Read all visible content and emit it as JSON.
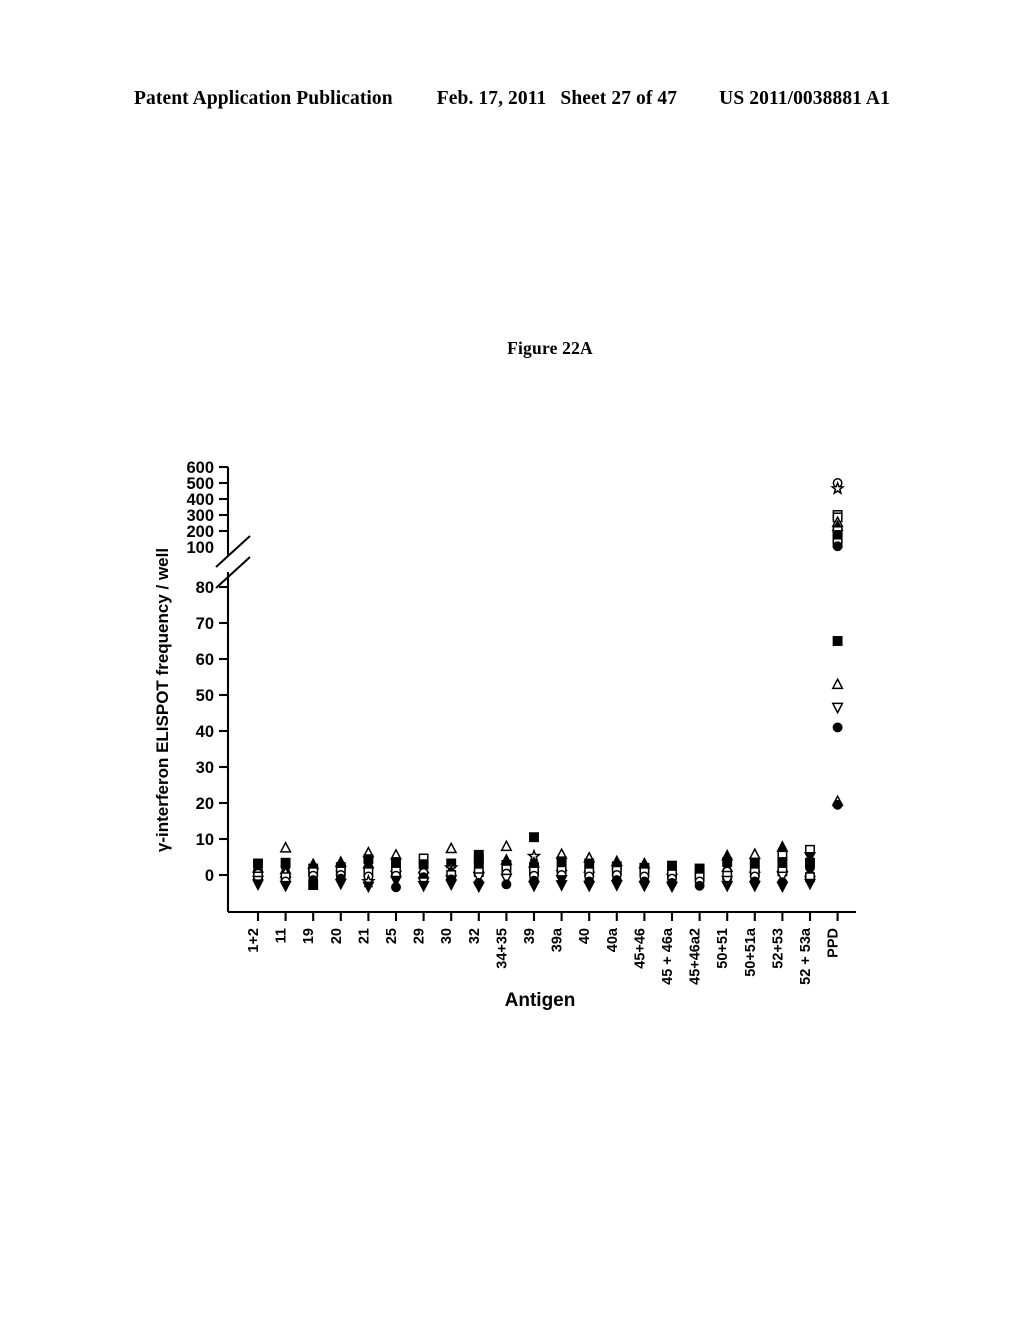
{
  "header": {
    "publication": "Patent Application Publication",
    "date": "Feb. 17, 2011",
    "sheet": "Sheet 27 of 47",
    "patent_number": "US 2011/0038881 A1"
  },
  "figure": {
    "title": "Figure 22A"
  },
  "chart_data": {
    "type": "scatter",
    "title": "Figure 22A",
    "xlabel": "Antigen",
    "ylabel": "γ-interferon ELISPOT frequency / well",
    "grid": false,
    "legend": "none",
    "axis_break": {
      "present": true,
      "lower_segment": [
        -5,
        80
      ],
      "upper_segment": [
        100,
        600
      ],
      "note": "y-axis broken between 80 and 100"
    },
    "ylim_lower": [
      -5,
      80
    ],
    "ylim_upper": [
      100,
      600
    ],
    "yticks_lower": [
      0,
      10,
      20,
      30,
      40,
      50,
      60,
      70,
      80
    ],
    "yticks_upper": [
      100,
      200,
      300,
      400,
      500,
      600
    ],
    "categories": [
      "1+2",
      "11",
      "19",
      "20",
      "21",
      "25",
      "29",
      "30",
      "32",
      "34+35",
      "39",
      "39a",
      "40",
      "40a",
      "45+46",
      "45 + 46a",
      "45+46a2",
      "50+51",
      "50+51a",
      "52+53",
      "52 + 53a",
      "PPD"
    ],
    "marker_shapes": [
      "filled-square",
      "open-square",
      "filled-triangle-up",
      "open-triangle-up",
      "filled-triangle-down",
      "open-triangle-down",
      "filled-circle",
      "open-circle",
      "star",
      "filled-diamond"
    ],
    "series": [
      {
        "name": "1+2",
        "points": [
          {
            "v": 3.2,
            "m": "filled-square"
          },
          {
            "v": 2.0,
            "m": "filled-triangle-up"
          },
          {
            "v": 1.2,
            "m": "filled-circle"
          },
          {
            "v": 0.4,
            "m": "open-circle"
          },
          {
            "v": -0.4,
            "m": "open-square"
          },
          {
            "v": -1.6,
            "m": "open-triangle-down"
          },
          {
            "v": -2.6,
            "m": "filled-triangle-down"
          }
        ]
      },
      {
        "name": "11",
        "points": [
          {
            "v": 7.6,
            "m": "open-triangle-up"
          },
          {
            "v": 3.4,
            "m": "filled-square"
          },
          {
            "v": 2.4,
            "m": "filled-circle"
          },
          {
            "v": 1.6,
            "m": "filled-triangle-up"
          },
          {
            "v": 0.6,
            "m": "open-triangle-up"
          },
          {
            "v": -0.6,
            "m": "open-square"
          },
          {
            "v": -1.8,
            "m": "open-circle"
          },
          {
            "v": -3.0,
            "m": "filled-triangle-down"
          }
        ]
      },
      {
        "name": "19",
        "points": [
          {
            "v": 3.0,
            "m": "filled-triangle-up"
          },
          {
            "v": 1.8,
            "m": "filled-square"
          },
          {
            "v": 0.8,
            "m": "open-square"
          },
          {
            "v": -0.2,
            "m": "open-circle"
          },
          {
            "v": -1.4,
            "m": "filled-circle"
          },
          {
            "v": -2.8,
            "m": "filled-square"
          }
        ]
      },
      {
        "name": "20",
        "points": [
          {
            "v": 3.6,
            "m": "filled-triangle-up"
          },
          {
            "v": 2.2,
            "m": "filled-square"
          },
          {
            "v": 1.0,
            "m": "open-square"
          },
          {
            "v": 0.0,
            "m": "open-circle"
          },
          {
            "v": -1.0,
            "m": "filled-circle"
          },
          {
            "v": -2.4,
            "m": "filled-triangle-down"
          }
        ]
      },
      {
        "name": "21",
        "points": [
          {
            "v": 6.2,
            "m": "open-triangle-up"
          },
          {
            "v": 4.4,
            "m": "filled-square"
          },
          {
            "v": 3.2,
            "m": "filled-triangle-up"
          },
          {
            "v": 2.0,
            "m": "filled-circle"
          },
          {
            "v": 0.8,
            "m": "open-square"
          },
          {
            "v": -0.4,
            "m": "open-circle"
          },
          {
            "v": -1.8,
            "m": "star"
          },
          {
            "v": -3.2,
            "m": "filled-triangle-down"
          }
        ]
      },
      {
        "name": "25",
        "points": [
          {
            "v": 5.6,
            "m": "open-triangle-up"
          },
          {
            "v": 3.6,
            "m": "filled-square"
          },
          {
            "v": 2.2,
            "m": "filled-triangle-up"
          },
          {
            "v": 1.0,
            "m": "open-square"
          },
          {
            "v": -0.2,
            "m": "open-circle"
          },
          {
            "v": -1.6,
            "m": "filled-triangle-down"
          },
          {
            "v": -3.4,
            "m": "filled-circle"
          }
        ]
      },
      {
        "name": "29",
        "points": [
          {
            "v": 4.6,
            "m": "open-square"
          },
          {
            "v": 3.0,
            "m": "filled-square"
          },
          {
            "v": 1.8,
            "m": "filled-triangle-up"
          },
          {
            "v": 0.6,
            "m": "open-circle"
          },
          {
            "v": -0.6,
            "m": "filled-circle"
          },
          {
            "v": -2.0,
            "m": "open-triangle-down"
          },
          {
            "v": -3.0,
            "m": "filled-triangle-down"
          }
        ]
      },
      {
        "name": "30",
        "points": [
          {
            "v": 7.4,
            "m": "open-triangle-up"
          },
          {
            "v": 3.2,
            "m": "filled-square"
          },
          {
            "v": 2.0,
            "m": "star"
          },
          {
            "v": 1.0,
            "m": "filled-triangle-up"
          },
          {
            "v": 0.0,
            "m": "open-square"
          },
          {
            "v": -1.2,
            "m": "filled-circle"
          },
          {
            "v": -2.6,
            "m": "filled-triangle-down"
          }
        ]
      },
      {
        "name": "32",
        "points": [
          {
            "v": 5.6,
            "m": "filled-square"
          },
          {
            "v": 4.4,
            "m": "filled-square"
          },
          {
            "v": 3.2,
            "m": "filled-square"
          },
          {
            "v": 2.0,
            "m": "filled-triangle-up"
          },
          {
            "v": 0.8,
            "m": "open-square"
          },
          {
            "v": -0.6,
            "m": "open-triangle-down"
          },
          {
            "v": -2.2,
            "m": "filled-circle"
          },
          {
            "v": -3.2,
            "m": "filled-triangle-down"
          }
        ]
      },
      {
        "name": "34+35",
        "points": [
          {
            "v": 8.0,
            "m": "open-triangle-up"
          },
          {
            "v": 4.2,
            "m": "filled-triangle-up"
          },
          {
            "v": 2.8,
            "m": "filled-square"
          },
          {
            "v": 1.6,
            "m": "open-square"
          },
          {
            "v": 0.4,
            "m": "open-circle"
          },
          {
            "v": -1.0,
            "m": "open-triangle-down"
          },
          {
            "v": -2.6,
            "m": "filled-circle"
          }
        ]
      },
      {
        "name": "39",
        "points": [
          {
            "v": 10.5,
            "m": "filled-square"
          },
          {
            "v": 5.2,
            "m": "star"
          },
          {
            "v": 3.4,
            "m": "filled-triangle-up"
          },
          {
            "v": 2.2,
            "m": "filled-square"
          },
          {
            "v": 1.0,
            "m": "open-square"
          },
          {
            "v": -0.2,
            "m": "open-circle"
          },
          {
            "v": -1.6,
            "m": "filled-circle"
          },
          {
            "v": -3.0,
            "m": "filled-triangle-down"
          }
        ]
      },
      {
        "name": "39a",
        "points": [
          {
            "v": 5.8,
            "m": "open-triangle-up"
          },
          {
            "v": 3.8,
            "m": "filled-square"
          },
          {
            "v": 2.4,
            "m": "filled-triangle-up"
          },
          {
            "v": 1.2,
            "m": "open-square"
          },
          {
            "v": 0.0,
            "m": "open-circle"
          },
          {
            "v": -1.4,
            "m": "filled-triangle-down"
          },
          {
            "v": -2.8,
            "m": "filled-triangle-down"
          }
        ]
      },
      {
        "name": "40",
        "points": [
          {
            "v": 4.8,
            "m": "open-triangle-up"
          },
          {
            "v": 3.2,
            "m": "filled-square"
          },
          {
            "v": 2.0,
            "m": "filled-triangle-up"
          },
          {
            "v": 0.8,
            "m": "open-square"
          },
          {
            "v": -0.4,
            "m": "open-circle"
          },
          {
            "v": -1.8,
            "m": "filled-circle"
          },
          {
            "v": -3.0,
            "m": "filled-triangle-down"
          }
        ]
      },
      {
        "name": "40a",
        "points": [
          {
            "v": 3.8,
            "m": "filled-triangle-up"
          },
          {
            "v": 2.4,
            "m": "filled-square"
          },
          {
            "v": 1.2,
            "m": "open-square"
          },
          {
            "v": 0.0,
            "m": "open-circle"
          },
          {
            "v": -1.4,
            "m": "filled-circle"
          },
          {
            "v": -2.8,
            "m": "filled-triangle-down"
          }
        ]
      },
      {
        "name": "45+46",
        "points": [
          {
            "v": 3.2,
            "m": "filled-triangle-up"
          },
          {
            "v": 2.0,
            "m": "filled-square"
          },
          {
            "v": 0.8,
            "m": "open-square"
          },
          {
            "v": -0.4,
            "m": "open-circle"
          },
          {
            "v": -1.8,
            "m": "filled-circle"
          },
          {
            "v": -3.0,
            "m": "filled-triangle-down"
          }
        ]
      },
      {
        "name": "45 + 46a",
        "points": [
          {
            "v": 2.6,
            "m": "filled-square"
          },
          {
            "v": 1.4,
            "m": "filled-triangle-up"
          },
          {
            "v": 0.2,
            "m": "open-square"
          },
          {
            "v": -1.0,
            "m": "open-circle"
          },
          {
            "v": -2.2,
            "m": "filled-circle"
          },
          {
            "v": -3.2,
            "m": "filled-triangle-down"
          }
        ]
      },
      {
        "name": "45+46a2",
        "points": [
          {
            "v": 1.8,
            "m": "filled-square"
          },
          {
            "v": 0.6,
            "m": "filled-square"
          },
          {
            "v": -0.6,
            "m": "open-square"
          },
          {
            "v": -1.8,
            "m": "open-circle"
          },
          {
            "v": -3.0,
            "m": "filled-circle"
          }
        ]
      },
      {
        "name": "50+51",
        "points": [
          {
            "v": 5.4,
            "m": "filled-triangle-up"
          },
          {
            "v": 3.6,
            "m": "filled-square"
          },
          {
            "v": 2.2,
            "m": "filled-triangle-up"
          },
          {
            "v": 1.0,
            "m": "open-circle"
          },
          {
            "v": -0.2,
            "m": "open-square"
          },
          {
            "v": -1.6,
            "m": "open-triangle-down"
          },
          {
            "v": -3.0,
            "m": "filled-triangle-down"
          }
        ]
      },
      {
        "name": "50+51a",
        "points": [
          {
            "v": 5.8,
            "m": "open-triangle-up"
          },
          {
            "v": 3.4,
            "m": "filled-square"
          },
          {
            "v": 2.0,
            "m": "filled-triangle-up"
          },
          {
            "v": 0.8,
            "m": "open-square"
          },
          {
            "v": -0.4,
            "m": "open-circle"
          },
          {
            "v": -1.8,
            "m": "filled-circle"
          },
          {
            "v": -3.0,
            "m": "filled-triangle-down"
          }
        ]
      },
      {
        "name": "52+53",
        "points": [
          {
            "v": 7.8,
            "m": "filled-triangle-up"
          },
          {
            "v": 5.4,
            "m": "open-square"
          },
          {
            "v": 3.6,
            "m": "filled-square"
          },
          {
            "v": 2.2,
            "m": "filled-triangle-up"
          },
          {
            "v": 1.0,
            "m": "open-square"
          },
          {
            "v": -0.4,
            "m": "open-triangle-down"
          },
          {
            "v": -2.0,
            "m": "filled-circle"
          },
          {
            "v": -3.2,
            "m": "filled-triangle-down"
          }
        ]
      },
      {
        "name": "52 + 53a",
        "points": [
          {
            "v": 7.0,
            "m": "open-square"
          },
          {
            "v": 5.0,
            "m": "filled-triangle-down"
          },
          {
            "v": 3.4,
            "m": "filled-square"
          },
          {
            "v": 2.0,
            "m": "filled-circle"
          },
          {
            "v": 0.8,
            "m": "filled-triangle-up"
          },
          {
            "v": -0.6,
            "m": "open-square"
          },
          {
            "v": -2.4,
            "m": "filled-triangle-down"
          }
        ]
      },
      {
        "name": "PPD",
        "points": [
          {
            "v": 500,
            "m": "open-circle"
          },
          {
            "v": 465,
            "m": "star"
          },
          {
            "v": 300,
            "m": "open-square"
          },
          {
            "v": 285,
            "m": "open-square"
          },
          {
            "v": 255,
            "m": "open-triangle-up"
          },
          {
            "v": 230,
            "m": "filled-triangle-up"
          },
          {
            "v": 200,
            "m": "open-square"
          },
          {
            "v": 175,
            "m": "filled-square"
          },
          {
            "v": 150,
            "m": "filled-square"
          },
          {
            "v": 125,
            "m": "open-square"
          },
          {
            "v": 105,
            "m": "filled-circle"
          },
          {
            "v": 65,
            "m": "filled-square"
          },
          {
            "v": 53,
            "m": "open-triangle-up"
          },
          {
            "v": 46.5,
            "m": "open-triangle-down"
          },
          {
            "v": 41,
            "m": "filled-circle"
          },
          {
            "v": 20.5,
            "m": "open-triangle-up"
          },
          {
            "v": 19.5,
            "m": "filled-circle"
          }
        ]
      }
    ]
  }
}
